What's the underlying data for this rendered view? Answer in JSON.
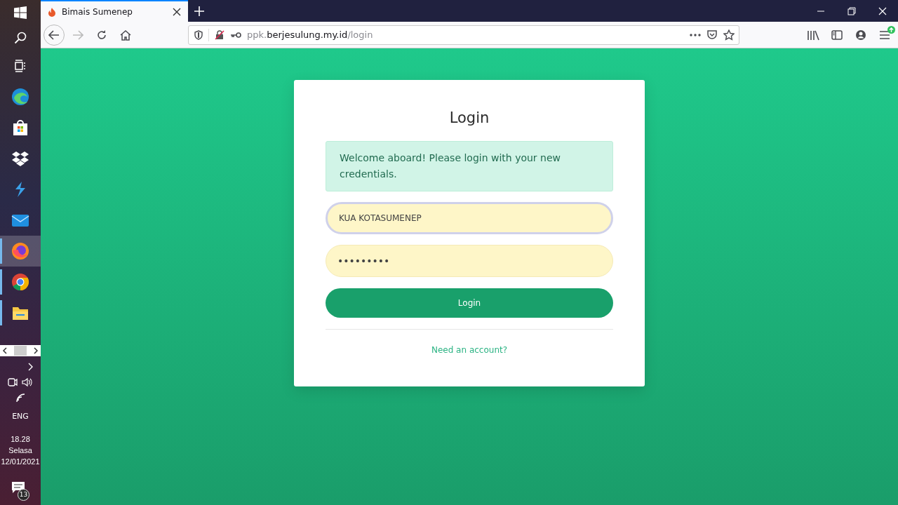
{
  "taskbar": {
    "apps": [
      {
        "kind": "task-view",
        "selected": false,
        "running": false
      },
      {
        "kind": "edge",
        "selected": false,
        "running": false
      },
      {
        "kind": "store",
        "selected": false,
        "running": false
      },
      {
        "kind": "dropbox",
        "selected": false,
        "running": false
      },
      {
        "kind": "bolt",
        "selected": false,
        "running": false
      },
      {
        "kind": "mail",
        "selected": false,
        "running": false
      },
      {
        "kind": "firefox",
        "selected": true,
        "running": true
      },
      {
        "kind": "chrome",
        "selected": false,
        "running": true
      },
      {
        "kind": "explorer",
        "selected": false,
        "running": true
      }
    ],
    "language": "ENG",
    "time": "18.28",
    "day": "Selasa",
    "date": "12/01/2021",
    "notifications": "13"
  },
  "browser": {
    "tabs": [
      {
        "title": "Bimais Sumenep",
        "selected": true
      }
    ],
    "url": {
      "prefix": "ppk.",
      "domain": "berjesulung.my.id",
      "path": "/login"
    },
    "forward_disabled": true,
    "update_badge": true
  },
  "login": {
    "title": "Login",
    "alert": "Welcome aboard! Please login with your new credentials.",
    "fields": [
      {
        "kind": "username",
        "value": "KUA KOTASUMENEP",
        "focused": true
      },
      {
        "kind": "password",
        "value": "•••••••••",
        "focused": false
      }
    ],
    "button": "Login",
    "link": "Need an account?"
  }
}
